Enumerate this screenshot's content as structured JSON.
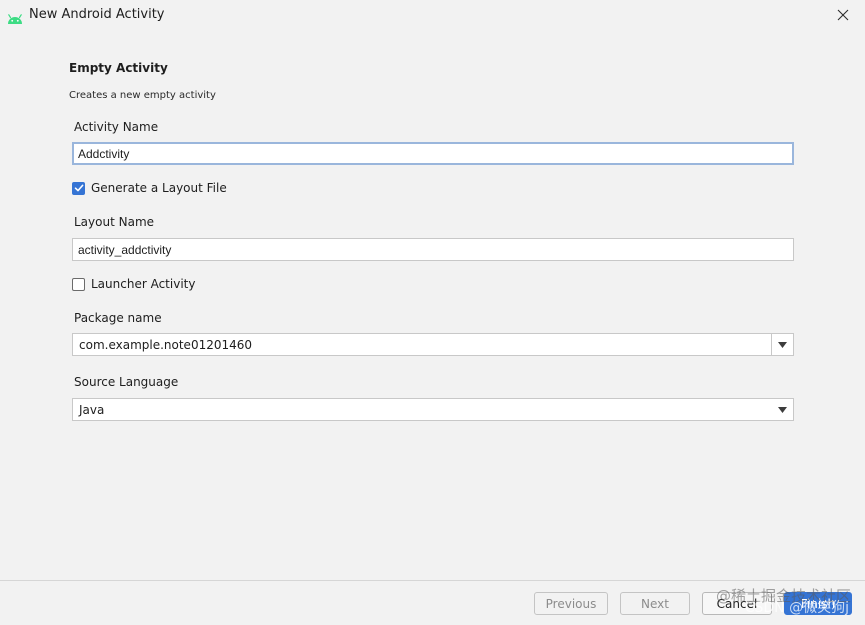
{
  "window": {
    "title": "New Android Activity",
    "icon": "android-icon",
    "close_icon": "close-icon"
  },
  "form": {
    "heading": "Empty Activity",
    "description": "Creates a new empty activity",
    "activity_name": {
      "label": "Activity Name",
      "value": "Addctivity"
    },
    "generate_layout": {
      "label": "Generate a Layout File",
      "checked": true
    },
    "layout_name": {
      "label": "Layout Name",
      "value": "activity_addctivity"
    },
    "launcher_activity": {
      "label": "Launcher Activity",
      "checked": false
    },
    "package_name": {
      "label": "Package name",
      "value": "com.example.note01201460"
    },
    "source_language": {
      "label": "Source Language",
      "value": "Java"
    }
  },
  "footer": {
    "previous_label": "Previous",
    "next_label": "Next",
    "cancel_label": "Cancel",
    "finish_label": "Finish"
  },
  "watermark": {
    "line1": "@稀土掘金技术社区",
    "line2": "CSDN @微笑狗j"
  },
  "colors": {
    "accent": "#3574d4",
    "focus_border": "#9ab6dc",
    "android_green": "#3ddc84"
  }
}
